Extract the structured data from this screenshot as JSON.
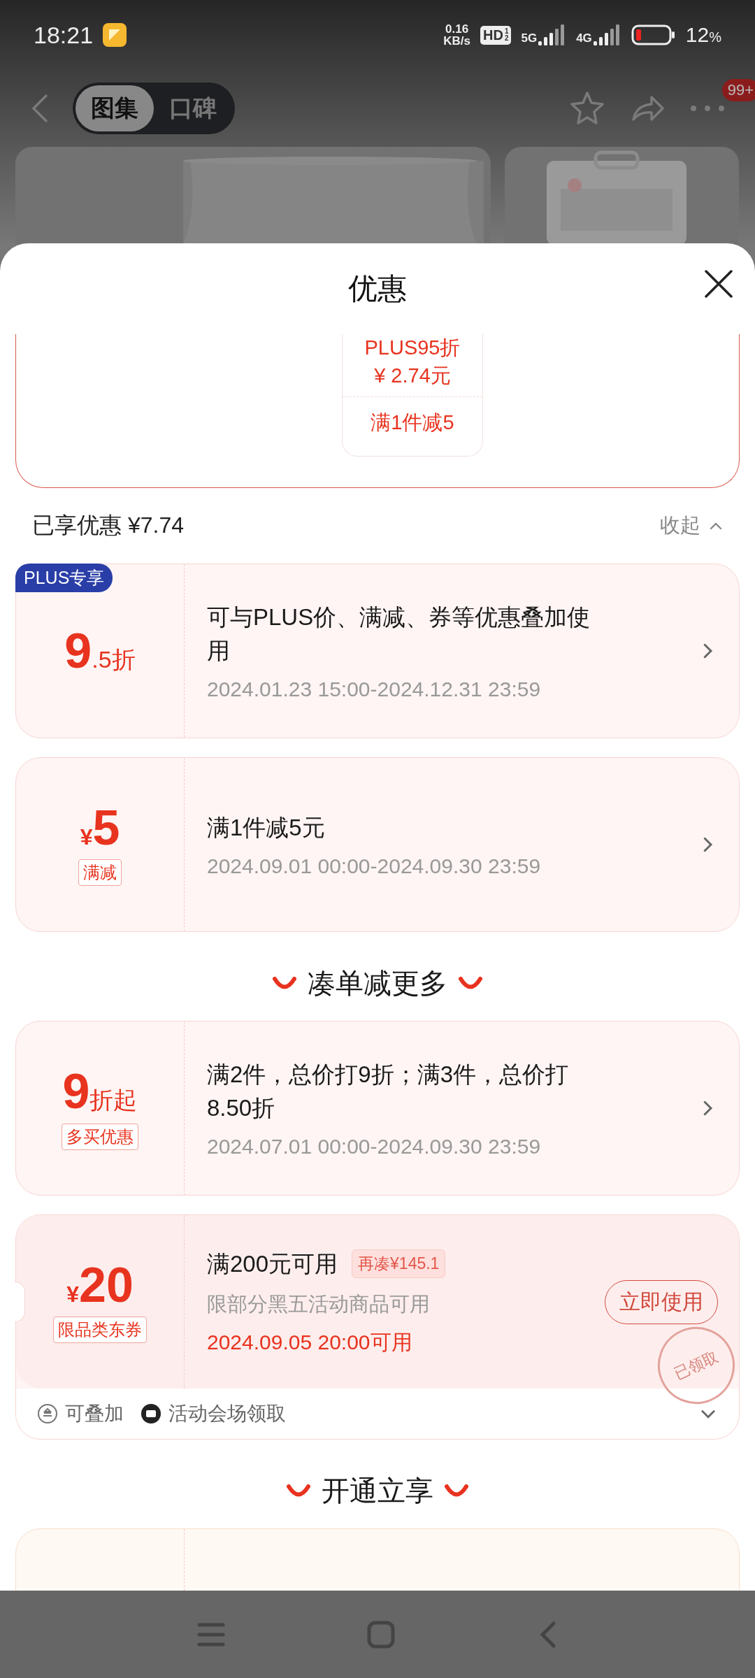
{
  "status_bar": {
    "time": "18:21",
    "speed_value": "0.16",
    "speed_unit": "KB/s",
    "hd": "HD",
    "hd_sub": [
      "1",
      "2"
    ],
    "networks": [
      "5G",
      "4G"
    ],
    "battery": "12",
    "battery_unit": "%"
  },
  "header": {
    "tabs": [
      {
        "label": "图集",
        "selected": true
      },
      {
        "label": "口碑",
        "selected": false
      }
    ],
    "badge": "99+"
  },
  "sheet": {
    "title": "优惠",
    "summary": {
      "lines": [
        "PLUS95折",
        "¥ 2.74元"
      ],
      "reduction": "满1件减5"
    },
    "savings": {
      "label": "已享优惠 ¥7.74",
      "toggle": "收起"
    },
    "blocks": [
      {
        "kind": "coupon",
        "ribbon": "PLUS专享",
        "big": "9",
        "small": ".5折",
        "title": "可与PLUS价、满减、券等优惠叠加使用",
        "date": "2024.01.23 15:00-2024.12.31 23:59"
      },
      {
        "kind": "coupon",
        "currency": "¥",
        "big": "5",
        "tag": "满减",
        "title": "满1件减5元",
        "date": "2024.09.01 00:00-2024.09.30 23:59"
      },
      {
        "kind": "heading",
        "text": "凑单减更多"
      },
      {
        "kind": "coupon",
        "big": "9",
        "small": "折起",
        "tag": "多买优惠",
        "title": "满2件，总价打9折；满3件，总价打8.50折",
        "date": "2024.07.01 00:00-2024.09.30 23:59"
      },
      {
        "kind": "coupon",
        "currency": "¥",
        "big": "20",
        "tag": "限品类东券",
        "title": "满200元可用",
        "title_badge": "再凑¥145.1",
        "subtitle": "限部分黑五活动商品可用",
        "available_from": "2024.09.05 20:00可用",
        "action": "立即使用",
        "stamp": "已领取",
        "footer": [
          "可叠加",
          "活动会场领取"
        ]
      },
      {
        "kind": "heading",
        "text": "开通立享"
      },
      {
        "kind": "cut_coupon"
      }
    ]
  }
}
